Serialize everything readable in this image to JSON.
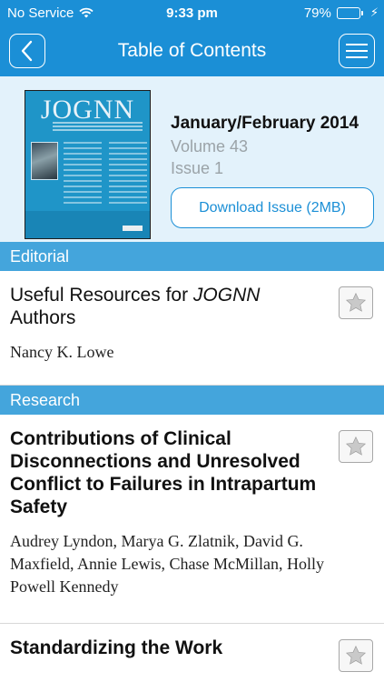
{
  "status_bar": {
    "carrier": "No Service",
    "time": "9:33 pm",
    "battery_percent": "79%",
    "battery_level": 0.79,
    "icons": [
      "wifi-icon",
      "battery-icon",
      "charging-bolt-icon"
    ]
  },
  "navbar": {
    "title": "Table of Contents",
    "back_icon": "chevron-left-icon",
    "menu_icon": "hamburger-menu-icon"
  },
  "issue": {
    "cover_title": "JOGNN",
    "date": "January/February 2014",
    "volume": "Volume 43",
    "issue_number": "Issue 1",
    "download_label": "Download Issue (2MB)"
  },
  "sections": [
    {
      "name": "Editorial",
      "articles": [
        {
          "title_prefix": "Useful Resources for ",
          "title_italic": "JOGNN",
          "title_suffix": " Authors",
          "authors": "Nancy K. Lowe"
        }
      ]
    },
    {
      "name": "Research",
      "articles": [
        {
          "title": "Contributions of Clinical Disconnections and Unresolved Conflict to Failures in Intrapartum Safety",
          "authors": "Audrey Lyndon, Marya G. Zlatnik, David G. Maxfield, Annie Lewis, Chase McMillan, Holly Powell Kennedy"
        },
        {
          "title": "Standardizing the Work"
        }
      ]
    }
  ],
  "colors": {
    "primary": "#1b8fd6",
    "section_bar": "#44a5dc",
    "issue_background": "#e3f2fb",
    "battery_fill": "#4cd964"
  }
}
